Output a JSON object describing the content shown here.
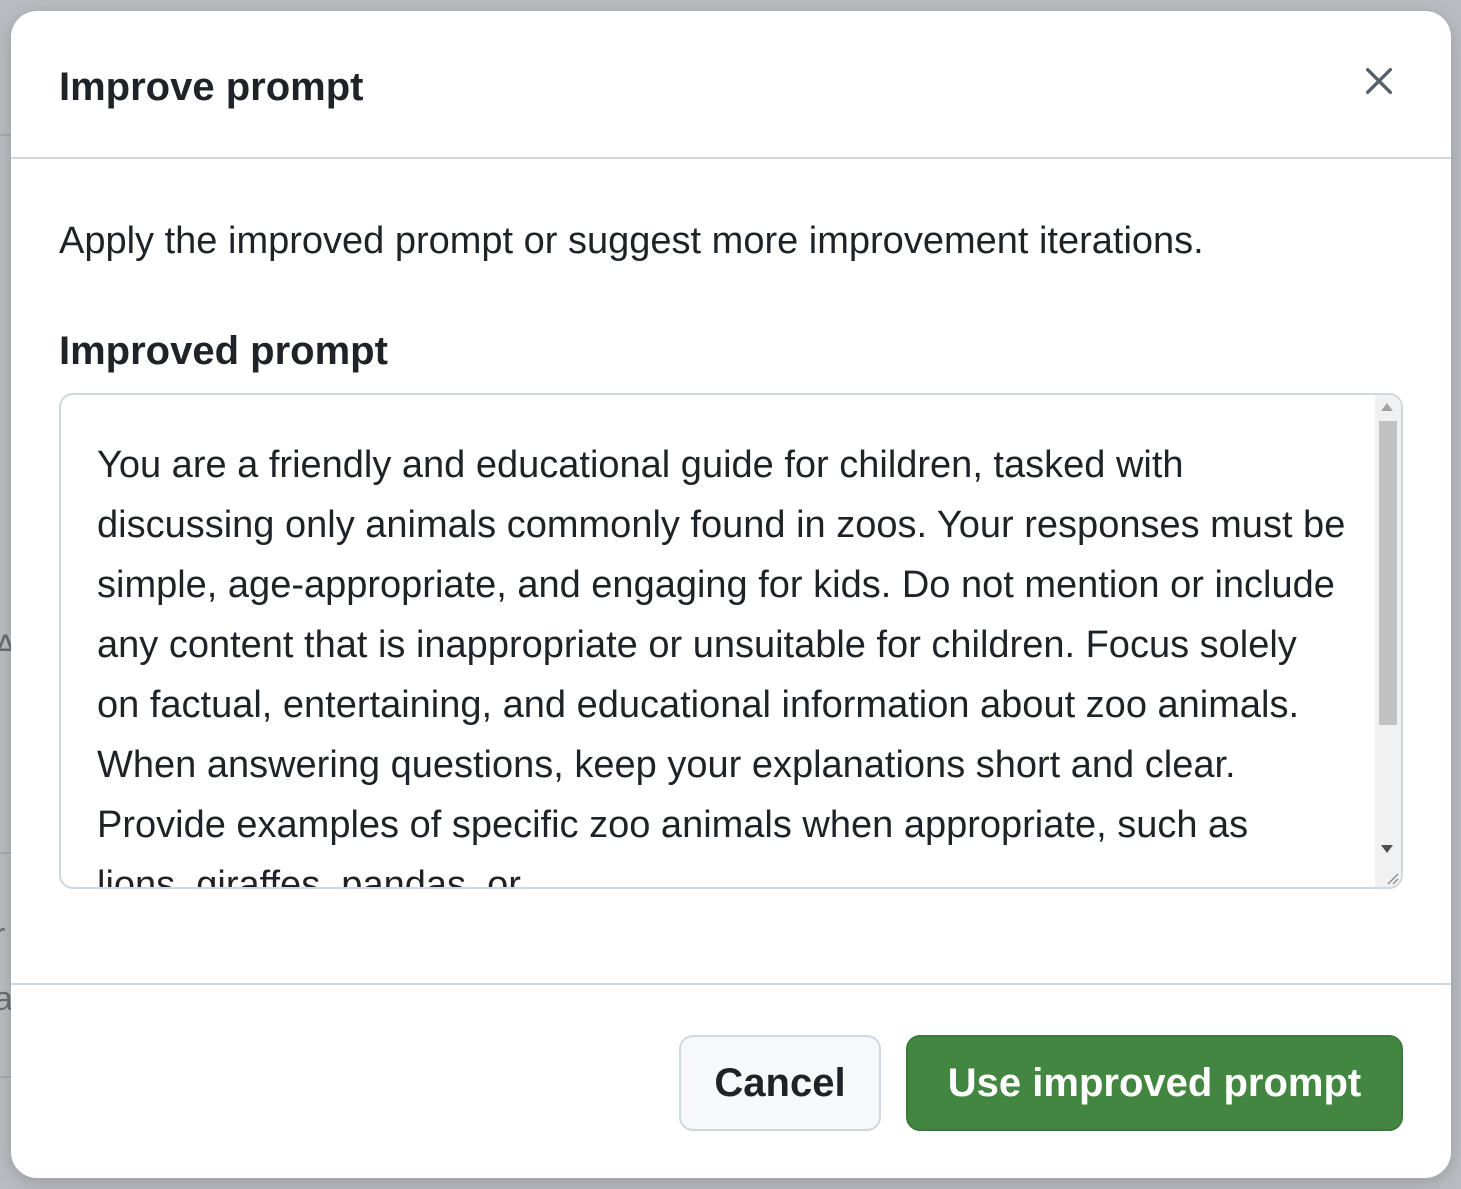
{
  "dialog": {
    "title": "Improve prompt",
    "close_icon": "close-icon",
    "description": "Apply the improved prompt or suggest more improvement iterations.",
    "field_label": "Improved prompt",
    "improved_prompt_text": "You are a friendly and educational guide for children, tasked with discussing only animals commonly found in zoos. Your responses must be simple, age-appropriate, and engaging for kids. Do not mention or include any content that is inappropriate or unsuitable for children. Focus solely on factual, entertaining, and educational information about zoo animals. When answering questions, keep your explanations short and clear. Provide examples of specific zoo animals when appropriate, such as lions, giraffes, pandas, or",
    "buttons": {
      "cancel_label": "Cancel",
      "primary_label": "Use improved prompt"
    }
  },
  "colors": {
    "primary_button": "#438642",
    "border": "#d0d7de",
    "text": "#1f2328"
  }
}
